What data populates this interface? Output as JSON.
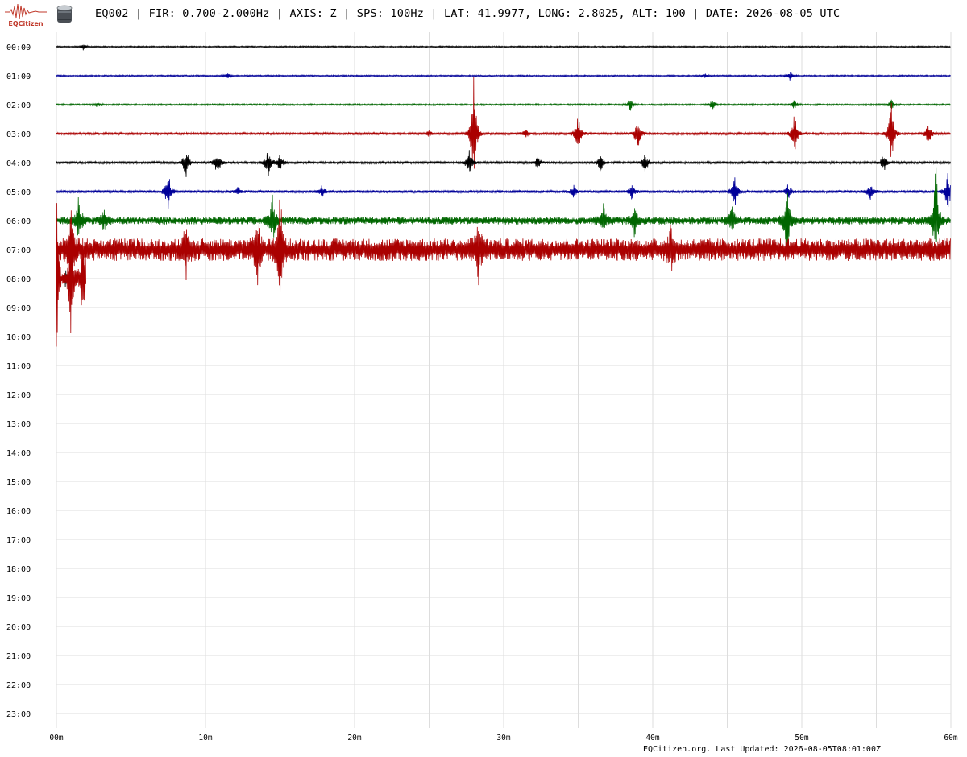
{
  "header": {
    "logo_text": "EQCitizen",
    "title": "EQ002 | FIR: 0.700-2.000Hz | AXIS: Z | SPS: 100Hz | LAT: 41.9977, LONG: 2.8025, ALT: 100 | DATE: 2026-08-05 UTC"
  },
  "footer": {
    "text": "EQCitizen.org. Last Updated: 2026-08-05T08:01:00Z"
  },
  "chart_data": {
    "type": "line",
    "hours": [
      "00:00",
      "01:00",
      "02:00",
      "03:00",
      "04:00",
      "05:00",
      "06:00",
      "07:00",
      "08:00",
      "09:00",
      "10:00",
      "11:00",
      "12:00",
      "13:00",
      "14:00",
      "15:00",
      "16:00",
      "17:00",
      "18:00",
      "19:00",
      "20:00",
      "21:00",
      "22:00",
      "23:00"
    ],
    "x_ticks": [
      "00m",
      "10m",
      "20m",
      "30m",
      "40m",
      "50m",
      "60m"
    ],
    "xlim": [
      0,
      60
    ],
    "grid": true,
    "trace_colors": [
      "#000000",
      "#000099",
      "#006600",
      "#aa0000"
    ],
    "traces": [
      {
        "hour": "00:00",
        "color": "#000000",
        "noise": 0.6,
        "bursts": [
          [
            1.8,
            3
          ]
        ]
      },
      {
        "hour": "01:00",
        "color": "#000099",
        "noise": 0.6,
        "bursts": [
          [
            11.5,
            2
          ],
          [
            43.5,
            2
          ],
          [
            49.2,
            5
          ]
        ]
      },
      {
        "hour": "02:00",
        "color": "#006600",
        "noise": 0.7,
        "bursts": [
          [
            2.8,
            3
          ],
          [
            38.5,
            8
          ],
          [
            44,
            5
          ],
          [
            49.5,
            5
          ],
          [
            56,
            5
          ]
        ]
      },
      {
        "hour": "03:00",
        "color": "#aa0000",
        "noise": 1.0,
        "bursts": [
          [
            25,
            3
          ],
          [
            28,
            60
          ],
          [
            31.5,
            5
          ],
          [
            35,
            20
          ],
          [
            39,
            20
          ],
          [
            49.5,
            22
          ],
          [
            56,
            35
          ],
          [
            58.5,
            12
          ]
        ]
      },
      {
        "hour": "04:00",
        "color": "#000000",
        "noise": 1.0,
        "bursts": [
          [
            8.7,
            18
          ],
          [
            10.8,
            15
          ],
          [
            14.2,
            15
          ],
          [
            15,
            10
          ],
          [
            27.7,
            15
          ],
          [
            32.3,
            8
          ],
          [
            36.5,
            10
          ],
          [
            39.5,
            10
          ],
          [
            55.5,
            10
          ]
        ]
      },
      {
        "hour": "05:00",
        "color": "#000099",
        "noise": 1.2,
        "bursts": [
          [
            7.5,
            22
          ],
          [
            12.2,
            5
          ],
          [
            17.8,
            6
          ],
          [
            34.7,
            6
          ],
          [
            38.6,
            8
          ],
          [
            45.5,
            18
          ],
          [
            49.1,
            8
          ],
          [
            54.6,
            10
          ],
          [
            59.8,
            22
          ]
        ]
      },
      {
        "hour": "06:00",
        "color": "#006600",
        "noise": 3.5,
        "bursts": [
          [
            1.5,
            25
          ],
          [
            3.2,
            10
          ],
          [
            14.5,
            25
          ],
          [
            36.7,
            15
          ],
          [
            38.8,
            18
          ],
          [
            45.3,
            20
          ],
          [
            49,
            40
          ],
          [
            59,
            60
          ]
        ]
      },
      {
        "hour": "07:00",
        "color": "#aa0000",
        "noise": 10,
        "bursts": [
          [
            1,
            48
          ],
          [
            8.7,
            25
          ],
          [
            13.5,
            40
          ],
          [
            15,
            55
          ],
          [
            28.3,
            30
          ],
          [
            41.2,
            22
          ]
        ]
      },
      {
        "hour": "08:00",
        "color": "#000000",
        "noise": 0,
        "bursts": [
          [
            0.6,
            12
          ]
        ],
        "end_minute": 1
      },
      {
        "hour": "08:00",
        "color": "#aa0000",
        "noise": 0,
        "bursts": [
          [
            0,
            90
          ],
          [
            1,
            80
          ],
          [
            1.8,
            70
          ]
        ],
        "end_minute": 2
      }
    ]
  }
}
